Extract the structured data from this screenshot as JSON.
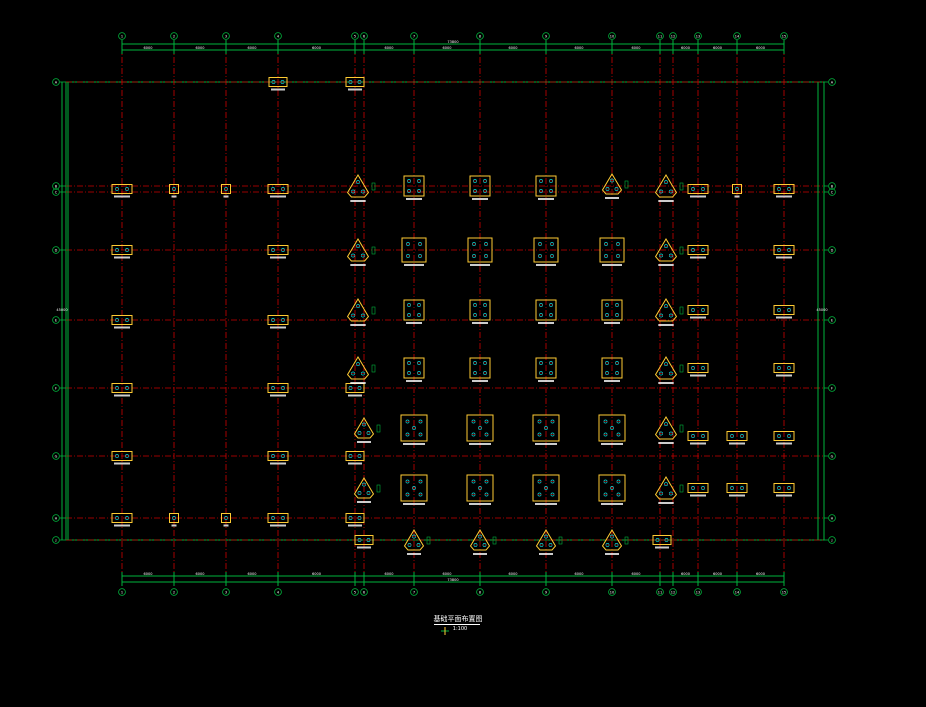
{
  "drawing": {
    "title": "基础平面布置图",
    "scale_note": "1:100",
    "colors": {
      "background": "#000000",
      "axis_grid": "#cc0000",
      "dimension": "#00b33c",
      "pile_cap": "#ffcc33",
      "pile": "#00ffff",
      "label": "#ffffff"
    },
    "dims": {
      "top_total": "73800",
      "bottom_total": "73800",
      "left_total": "45000",
      "right_total": "45000",
      "bay": "6000"
    },
    "col_axes": [
      "1",
      "2",
      "3",
      "4",
      "5",
      "6",
      "7",
      "8",
      "9",
      "10",
      "11",
      "12",
      "13",
      "14",
      "15"
    ],
    "row_axes": [
      "A",
      "B",
      "C",
      "D",
      "E",
      "F",
      "G",
      "H",
      "J",
      "K"
    ]
  }
}
